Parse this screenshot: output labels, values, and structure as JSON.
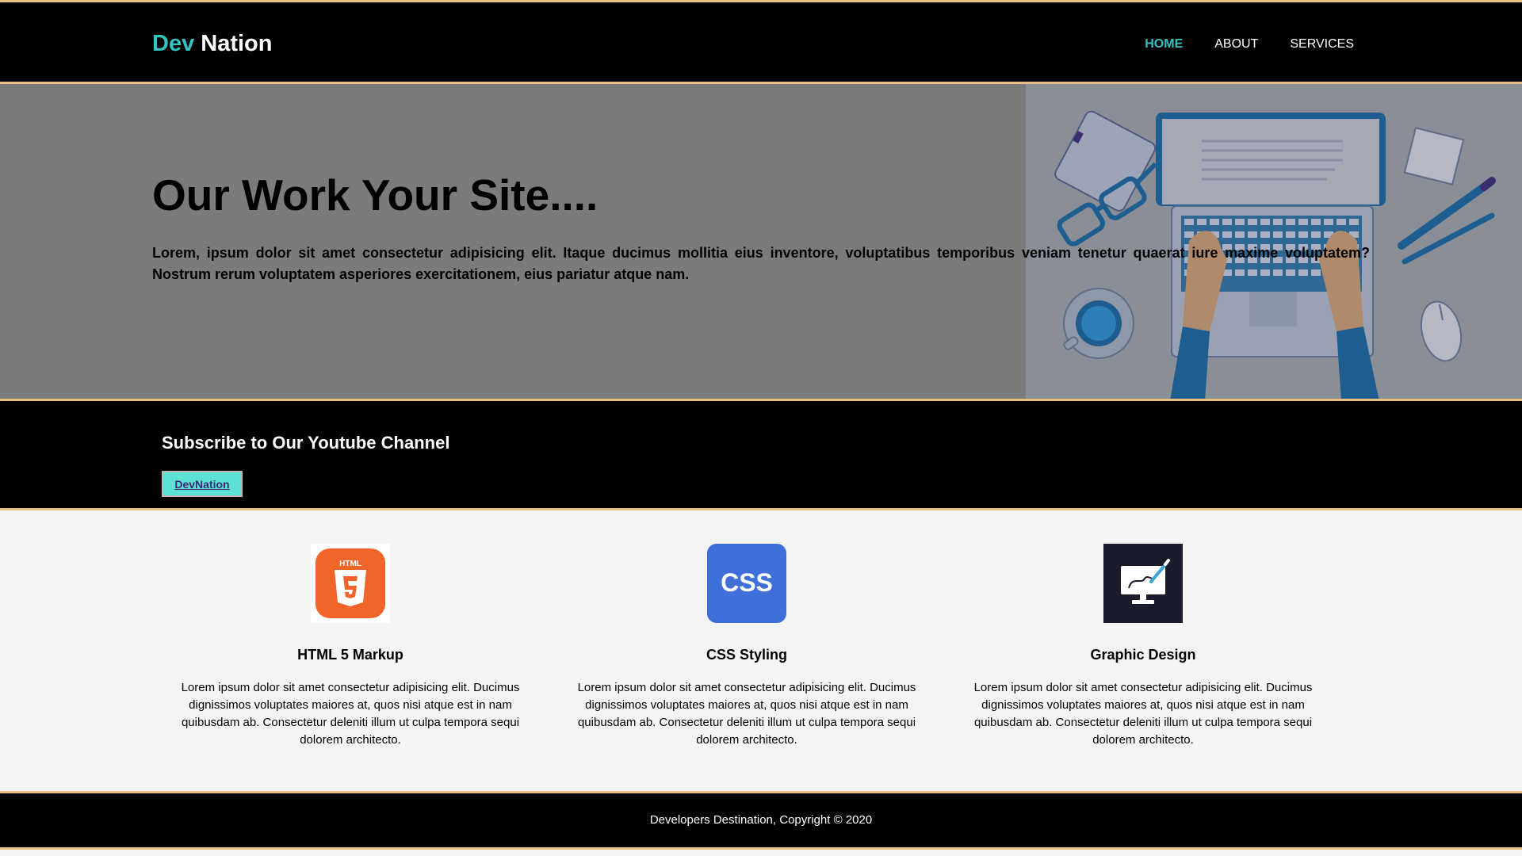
{
  "header": {
    "brand_highlight": "Dev",
    "brand_rest": "Nation",
    "nav": [
      {
        "label": "HOME",
        "current": true
      },
      {
        "label": "ABOUT",
        "current": false
      },
      {
        "label": "SERVICES",
        "current": false
      }
    ]
  },
  "showcase": {
    "heading": "Our Work Your Site....",
    "text": "Lorem, ipsum dolor sit amet consectetur adipisicing elit. Itaque ducimus mollitia eius inventore, voluptatibus temporibus veniam tenetur quaerat iure maxime voluptatem? Nostrum rerum voluptatem asperiores exercitationem, eius pariatur atque nam."
  },
  "newsletter": {
    "heading": "Subscribe to Our Youtube Channel",
    "button_label": "DevNation"
  },
  "boxes": [
    {
      "icon": "html5-logo-icon",
      "title": "HTML 5 Markup",
      "text": "Lorem ipsum dolor sit amet consectetur adipisicing elit. Ducimus dignissimos voluptates maiores at, quos nisi atque est in nam quibusdam ab. Consectetur deleniti illum ut culpa tempora sequi dolorem architecto."
    },
    {
      "icon": "css-logo-icon",
      "icon_text": "CSS",
      "title": "CSS Styling",
      "text": "Lorem ipsum dolor sit amet consectetur adipisicing elit. Ducimus dignissimos voluptates maiores at, quos nisi atque est in nam quibusdam ab. Consectetur deleniti illum ut culpa tempora sequi dolorem architecto."
    },
    {
      "icon": "graphic-design-icon",
      "title": "Graphic Design",
      "text": "Lorem ipsum dolor sit amet consectetur adipisicing elit. Ducimus dignissimos voluptates maiores at, quos nisi atque est in nam quibusdam ab. Consectetur deleniti illum ut culpa tempora sequi dolorem architecto."
    }
  ],
  "footer": {
    "text": "Developers Destination, Copyright © 2020"
  },
  "colors": {
    "accent": "#35c3c1",
    "border_gold": "#e8c07d",
    "button_bg": "#5ce1d5",
    "showcase_bg": "#7b7b7b",
    "html5_orange": "#f16529",
    "css_blue": "#3f6fd9",
    "design_navy": "#1b1b2e"
  }
}
